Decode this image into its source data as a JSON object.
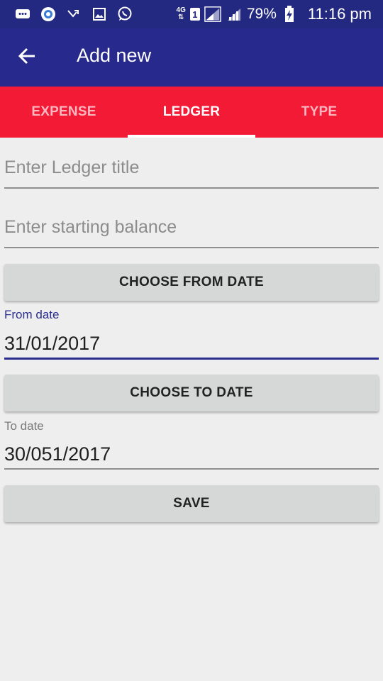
{
  "status_bar": {
    "network_label_top": "4G",
    "network_label_bottom": "⇅",
    "sim_slot": "1",
    "battery_percent": "79%",
    "time": "11:16 pm",
    "icons": [
      "message-icon",
      "browser-icon",
      "missed-call-icon",
      "image-icon",
      "whatsapp-icon",
      "signal-icon",
      "signal-icon",
      "battery-charging-icon"
    ]
  },
  "app_bar": {
    "title": "Add new",
    "back_icon": "arrow-back-icon",
    "color": "#27298c"
  },
  "tabs": {
    "items": [
      {
        "label": "EXPENSE",
        "active": false
      },
      {
        "label": "LEDGER",
        "active": true
      },
      {
        "label": "TYPE",
        "active": false
      }
    ],
    "color": "#f21a35"
  },
  "form": {
    "ledger_title": {
      "placeholder": "Enter Ledger title",
      "value": ""
    },
    "starting_balance": {
      "placeholder": "Enter starting balance",
      "value": ""
    },
    "choose_from_date_label": "CHOOSE FROM DATE",
    "from_date": {
      "label": "From date",
      "value": "31/01/2017"
    },
    "choose_to_date_label": "CHOOSE TO DATE",
    "to_date": {
      "label": "To date",
      "value": "30/051/2017"
    },
    "save_label": "SAVE"
  }
}
